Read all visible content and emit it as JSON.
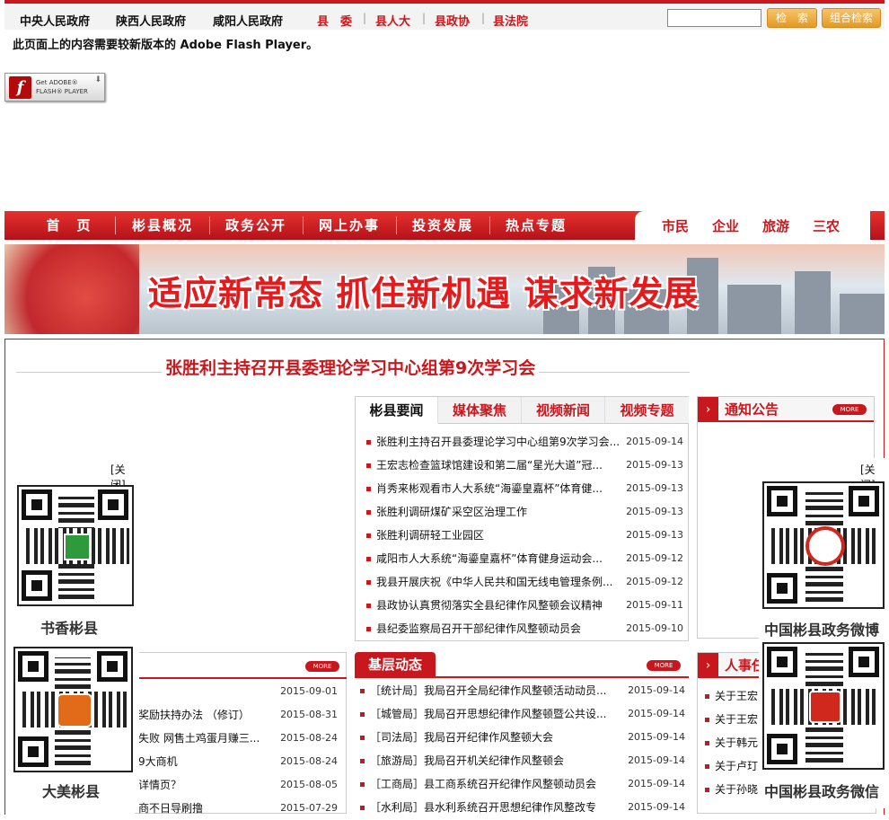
{
  "topbar": {
    "gov_links": [
      "中央人民政府",
      "陕西人民政府",
      "咸阳人民政府"
    ],
    "county_links": [
      "县　委",
      "县人大",
      "县政协",
      "县法院"
    ],
    "search_button": "检　索",
    "combo_search_button": "组合检索"
  },
  "flash": {
    "notice": "此页面上的内容需要较新版本的 Adobe Flash Player。",
    "badge_line1": "Get ADOBE®",
    "badge_line2": "FLASH® PLAYER"
  },
  "nav": {
    "items": [
      "首　页",
      "彬县概况",
      "政务公开",
      "网上办事",
      "投资发展",
      "热点专题"
    ],
    "right_items": [
      "市民",
      "企业",
      "旅游",
      "三农"
    ]
  },
  "banner": {
    "slogan": "适应新常态 抓住新机遇 谋求新发展"
  },
  "headline": "张胜利主持召开县委理论学习中心组第9次学习会",
  "news": {
    "tabs": [
      "彬县要闻",
      "媒体聚焦",
      "视频新闻",
      "视频专题"
    ],
    "rows": [
      {
        "title": "张胜利主持召开县委理论学习中心组第9次学习会...",
        "date": "2015-09-14"
      },
      {
        "title": "王宏志检查篮球馆建设和第二届“星光大道”冠...",
        "date": "2015-09-13"
      },
      {
        "title": "肖秀来彬观看市人大系统“海鎏皇嘉杯”体育健...",
        "date": "2015-09-13"
      },
      {
        "title": "张胜利调研煤矿采空区治理工作",
        "date": "2015-09-13"
      },
      {
        "title": "张胜利调研轻工业园区",
        "date": "2015-09-13"
      },
      {
        "title": "咸阳市人大系统“海鎏皇嘉杯”体育健身运动会...",
        "date": "2015-09-12"
      },
      {
        "title": "我县开展庆祝《中华人民共和国无线电管理条例...",
        "date": "2015-09-12"
      },
      {
        "title": "县政协认真贯彻落实全县纪律作风整顿会议精神",
        "date": "2015-09-11"
      },
      {
        "title": "县纪委监察局召开干部纪律作风整顿动员会",
        "date": "2015-09-10"
      }
    ]
  },
  "notice": {
    "title": "通知公告",
    "more": "MORE"
  },
  "left_list": {
    "more": "MORE",
    "rows": [
      {
        "title": "",
        "date": "2015-09-01"
      },
      {
        "title": "奖励扶持办法 （修订）",
        "date": "2015-08-31"
      },
      {
        "title": "失败 网售土鸡蛋月赚三...",
        "date": "2015-08-24"
      },
      {
        "title": "9大商机",
        "date": "2015-08-24"
      },
      {
        "title": "详情页？",
        "date": "2015-08-05"
      },
      {
        "title": "商不日导刷撸",
        "date": "2015-07-29"
      }
    ]
  },
  "jiceng": {
    "title": "基层动态",
    "more": "MORE",
    "rows": [
      {
        "title": "［统计局］我局召开全局纪律作风整顿活动动员...",
        "date": "2015-09-14"
      },
      {
        "title": "［城管局］我局召开思想纪律作风整顿暨公共设...",
        "date": "2015-09-14"
      },
      {
        "title": "［司法局］我局召开纪律作风整顿大会",
        "date": "2015-09-14"
      },
      {
        "title": "［旅游局］我局召开机关纪律作风整顿会",
        "date": "2015-09-14"
      },
      {
        "title": "［工商局］县工商系统召开纪律作风整顿动员会",
        "date": "2015-09-14"
      },
      {
        "title": "［水利局］县水利系统召开思想纪律作风整改专",
        "date": "2015-09-14"
      }
    ]
  },
  "hr": {
    "title": "人事任",
    "rows": [
      "关于王宏",
      "关于王宏",
      "关于韩元",
      "关于卢玎",
      "关于孙晓"
    ]
  },
  "qr_left": {
    "close": "[关闭]",
    "caption1": "书香彬县",
    "caption2": "大美彬县"
  },
  "qr_right": {
    "close": "[关闭]",
    "caption1": "中国彬县政务微博",
    "caption2": "中国彬县政务微信"
  }
}
